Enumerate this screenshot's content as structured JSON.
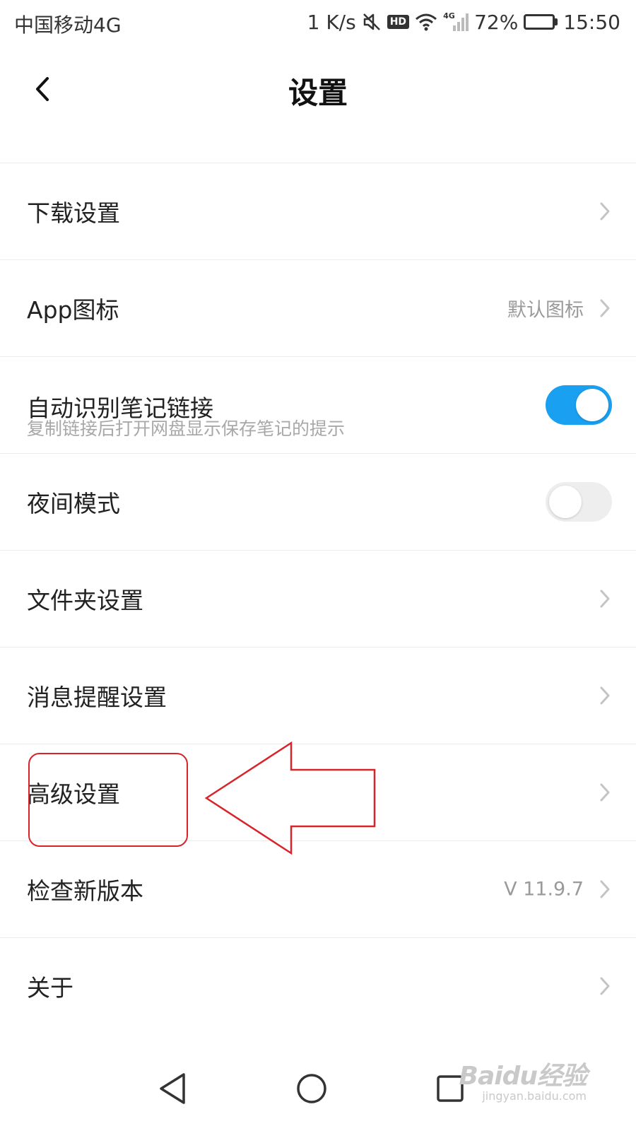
{
  "status_bar": {
    "carrier": "中国移动4G",
    "speed": "1 K/s",
    "hd": "HD",
    "network_type": "4G",
    "battery_percent": "72%",
    "battery_level": 0.72,
    "time": "15:50"
  },
  "header": {
    "title": "设置"
  },
  "settings": {
    "items": [
      {
        "label": "下载设置"
      },
      {
        "label": "App图标",
        "value": "默认图标"
      },
      {
        "label": "自动识别笔记链接",
        "sublabel": "复制链接后打开网盘显示保存笔记的提示",
        "toggle": true
      },
      {
        "label": "夜间模式",
        "toggle": false
      },
      {
        "label": "文件夹设置"
      },
      {
        "label": "消息提醒设置"
      },
      {
        "label": "高级设置"
      },
      {
        "label": "检查新版本",
        "value": "V 11.9.7"
      },
      {
        "label": "关于"
      }
    ]
  },
  "watermark": {
    "logo": "Baidu经验",
    "url": "jingyan.baidu.com"
  },
  "colors": {
    "toggle_on": "#1aa0f0",
    "annotation": "#d8232a"
  }
}
